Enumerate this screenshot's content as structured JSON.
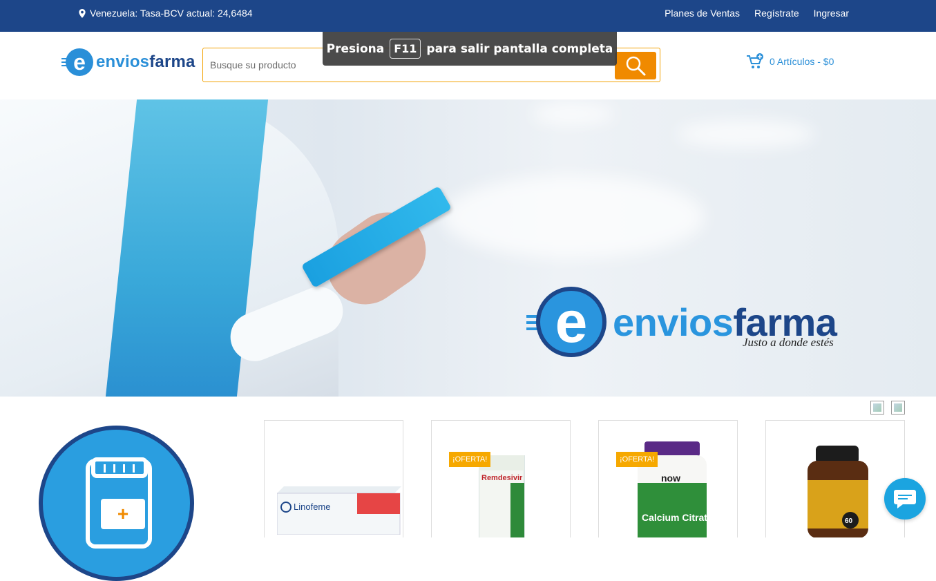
{
  "topbar": {
    "location": "Venezuela: Tasa-BCV actual: 24,6484",
    "links": [
      "Planes de Ventas",
      "Regístrate",
      "Ingresar"
    ]
  },
  "header": {
    "logo_e": "e",
    "logo_word_1": "envios",
    "logo_word_2": "farma",
    "search_placeholder": "Busque su producto",
    "cart_label": "0 Artículos - $0"
  },
  "fullscreen_notice": {
    "before": "Presiona",
    "key": "F11",
    "after": "para salir pantalla completa"
  },
  "hero": {
    "brand_e": "e",
    "brand_word_1": "envios",
    "brand_word_2": "farma",
    "slogan": "Justo a donde estés"
  },
  "products": [
    {
      "badge": "",
      "name": "Linofeme"
    },
    {
      "badge": "¡OFERTA!",
      "name": "Remdesivir"
    },
    {
      "badge": "¡OFERTA!",
      "name": "Calcium Citrate"
    },
    {
      "badge": "",
      "name": "60"
    }
  ],
  "colors": {
    "topbar": "#1d4689",
    "accent": "#2a8fd8",
    "orange": "#f08a00",
    "badge": "#f6a800"
  }
}
